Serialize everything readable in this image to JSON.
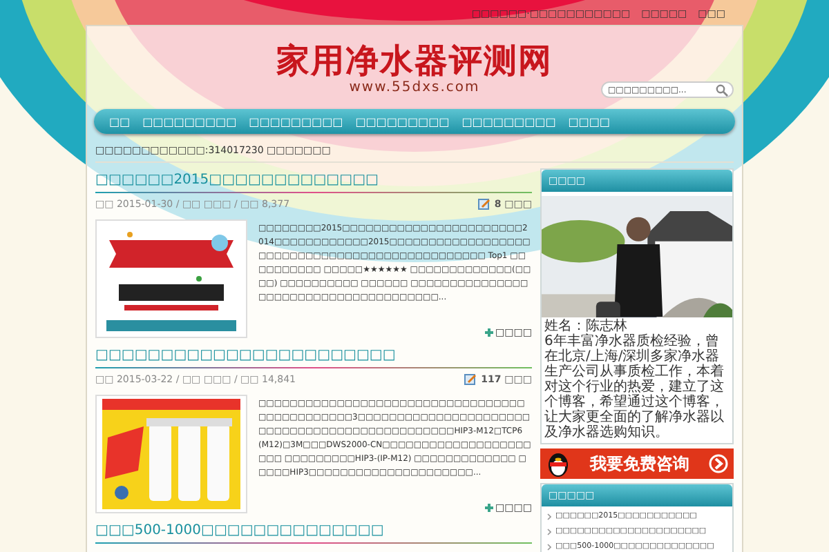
{
  "top_links": [
    "□□□□□□·□□□□□□□□□□□",
    "□□□□□",
    "□□□"
  ],
  "logo": {
    "title": "家用净水器评测网",
    "url": "www.55dxs.com"
  },
  "search": {
    "placeholder": "□□□□□□□□□..."
  },
  "nav": [
    {
      "label": "□□",
      "selected": false
    },
    {
      "label": "□□□□□□□□□",
      "selected": false
    },
    {
      "label": "□□□□□□□□□",
      "selected": false
    },
    {
      "label": "□□□□□□□□□",
      "selected": false
    },
    {
      "label": "□□□□□□□□□",
      "selected": false
    },
    {
      "label": "□□□□",
      "selected": false
    }
  ],
  "notice": "□□□□□□□□□□□□:314017230 □□□□□□□",
  "posts": [
    {
      "title": "□□□□□□2015□□□□□□□□□□□□□",
      "meta": "□□ 2015-01-30 / □□ □□□ / □□ 8,377",
      "comments": "8 □□□",
      "excerpt": "□□□□□□□□2015□□□□□□□□□□□□□□□□□□□□□□□2014□□□□□□□□□□□□2015□□□□□□□□□□□□□□□□□□□□□□□□□□□□□□□□□□□□□□□□□□□□□□□ Top1 □□□□□□□□□□ □□□□□★★★★★★ □□□□□□□□□□□□□(□□□□) □□□□□□□□□□ □□□□□□ □□□□□□□□□□□□□□□□□□□□□□□□□□□□□□□□□□□□□□...",
      "more": "□□□□"
    },
    {
      "title": "□□□□□□□□□□□□□□□□□□□□□□□",
      "meta": "□□ 2015-03-22 / □□ □□□ / □□ 14,841",
      "comments": "117 □□□",
      "excerpt": "□□□□□□□□□□□□□□□□□□□□□□□□□□□□□□□□□□□□□□□□□□□□□□3□□□□□□□□□□□□□□□□□□□□□□□□□□□□□□□□□□□□□□□□□□□□□□□HIP3-M12□TCP6(M12)□3M□□□DWS2000-CN□□□□□□□□□□□□□□□□□□□□□□ □□□□□□□□□HIP3-(IP-M12) □□□□□□□□□□□□□ □□□□□HIP3□□□□□□□□□□□□□□□□□□□□□...",
      "more": "□□□□"
    },
    {
      "title": "□□□500-1000□□□□□□□□□□□□□□"
    }
  ],
  "sidebar": {
    "about": {
      "title": "□□□□",
      "name": "姓名：陈志林",
      "bio": "6年丰富净水器质检经验，曾在北京/上海/深圳多家净水器生产公司从事质检工作，本着对这个行业的热爱，建立了这个博客，希望通过这个博客，让大家更全面的了解净水器以及净水器选购知识。",
      "banner": "我要免费咨询"
    },
    "latest": {
      "title": "□□□□□",
      "items": [
        "□□□□□□2015□□□□□□□□□□□",
        "□□□□□□□□□□□□□□□□□□□□□",
        "□□□500-1000□□□□□□□□□□□□□□"
      ]
    }
  }
}
